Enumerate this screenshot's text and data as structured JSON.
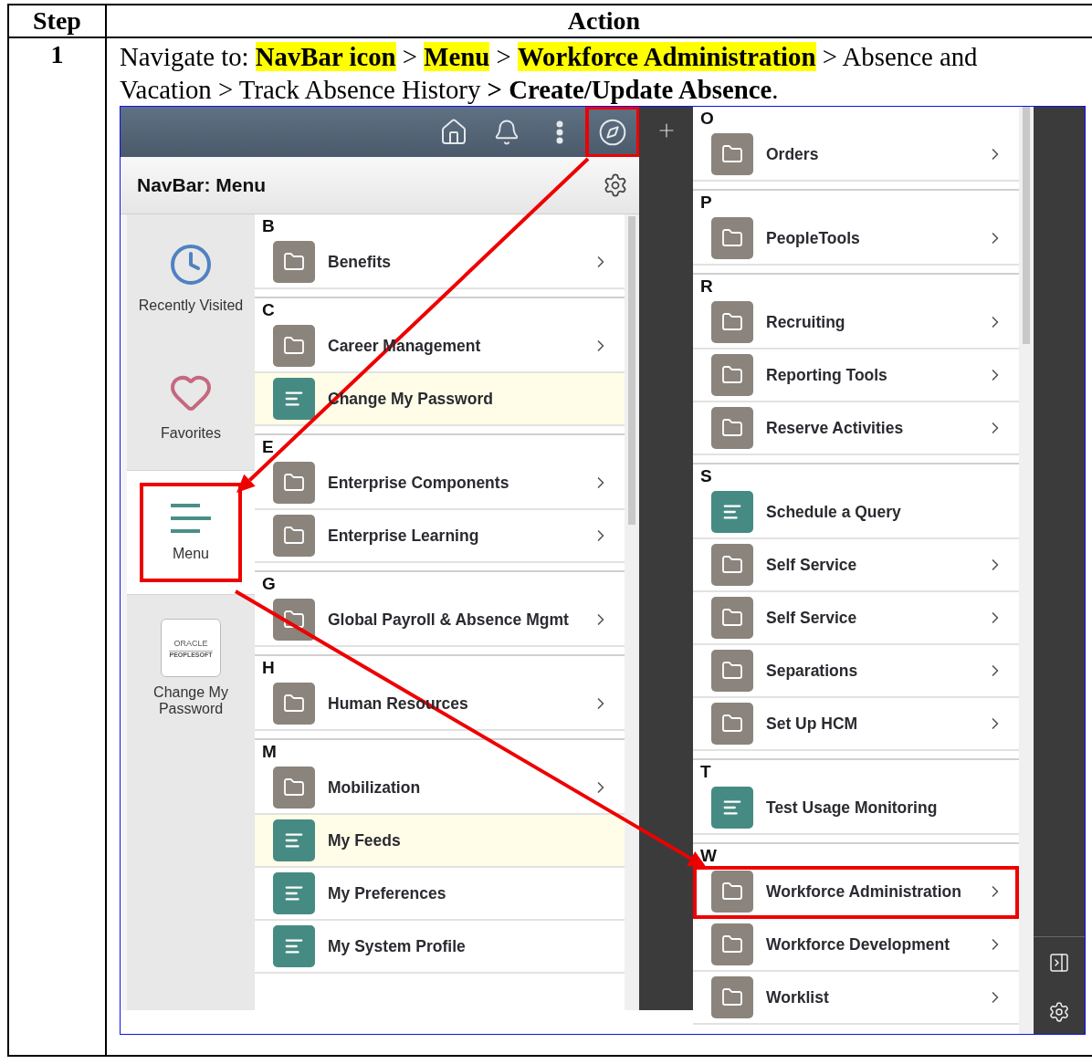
{
  "table": {
    "columns": [
      "Step",
      "Action"
    ],
    "rows": [
      {
        "step": "1",
        "instruction": [
          {
            "text": "Navigate to: ",
            "bold": false,
            "highlight": false
          },
          {
            "text": "NavBar icon",
            "bold": true,
            "highlight": true
          },
          {
            "text": " > ",
            "bold": false,
            "highlight": false
          },
          {
            "text": "Menu",
            "bold": true,
            "highlight": true
          },
          {
            "text": " > ",
            "bold": false,
            "highlight": false
          },
          {
            "text": "Workforce Administration",
            "bold": true,
            "highlight": true
          },
          {
            "text": " > Absence and Vacation > Track Absence History ",
            "bold": false,
            "highlight": false
          },
          {
            "text": "> Create/Update Absence",
            "bold": true,
            "highlight": false
          },
          {
            "text": ".",
            "bold": false,
            "highlight": false
          }
        ]
      }
    ]
  },
  "screenshot": {
    "top_bar": {
      "navbar_annotated": true
    },
    "panel_title": "NavBar: Menu",
    "nav_items": [
      {
        "kind": "recent",
        "label": "Recently Visited",
        "selected": false,
        "annotated": false
      },
      {
        "kind": "favorites",
        "label": "Favorites",
        "selected": false,
        "annotated": false
      },
      {
        "kind": "menu",
        "label": "Menu",
        "selected": true,
        "annotated": true
      },
      {
        "kind": "tile",
        "label": "Change My Password",
        "logo": [
          "ORACLE",
          "PEOPLESOFT"
        ],
        "selected": false,
        "annotated": false
      }
    ],
    "left_sections": [
      {
        "letter": "B",
        "items": [
          {
            "label": "Benefits",
            "kind": "folder",
            "highlighted": false,
            "annotated": false
          }
        ]
      },
      {
        "letter": "C",
        "items": [
          {
            "label": "Career Management",
            "kind": "folder",
            "highlighted": false,
            "annotated": false
          },
          {
            "label": "Change My Password",
            "kind": "page",
            "highlighted": true,
            "annotated": false
          }
        ]
      },
      {
        "letter": "E",
        "items": [
          {
            "label": "Enterprise Components",
            "kind": "folder",
            "highlighted": false,
            "annotated": false
          },
          {
            "label": "Enterprise Learning",
            "kind": "folder",
            "highlighted": false,
            "annotated": false
          }
        ]
      },
      {
        "letter": "G",
        "items": [
          {
            "label": "Global Payroll & Absence Mgmt",
            "kind": "folder",
            "highlighted": false,
            "annotated": false
          }
        ]
      },
      {
        "letter": "H",
        "items": [
          {
            "label": "Human Resources",
            "kind": "folder",
            "highlighted": false,
            "annotated": false
          }
        ]
      },
      {
        "letter": "M",
        "items": [
          {
            "label": "Mobilization",
            "kind": "folder",
            "highlighted": false,
            "annotated": false
          },
          {
            "label": "My Feeds",
            "kind": "page",
            "highlighted": true,
            "annotated": false
          },
          {
            "label": "My Preferences",
            "kind": "page",
            "highlighted": false,
            "annotated": false
          },
          {
            "label": "My System Profile",
            "kind": "page",
            "highlighted": false,
            "annotated": false
          }
        ]
      }
    ],
    "right_sections": [
      {
        "letter": "O",
        "items": [
          {
            "label": "Orders",
            "kind": "folder",
            "highlighted": false,
            "annotated": false
          }
        ]
      },
      {
        "letter": "P",
        "items": [
          {
            "label": "PeopleTools",
            "kind": "folder",
            "highlighted": false,
            "annotated": false
          }
        ]
      },
      {
        "letter": "R",
        "items": [
          {
            "label": "Recruiting",
            "kind": "folder",
            "highlighted": false,
            "annotated": false
          },
          {
            "label": "Reporting Tools",
            "kind": "folder",
            "highlighted": false,
            "annotated": false
          },
          {
            "label": "Reserve Activities",
            "kind": "folder",
            "highlighted": false,
            "annotated": false
          }
        ]
      },
      {
        "letter": "S",
        "items": [
          {
            "label": "Schedule a Query",
            "kind": "page",
            "highlighted": false,
            "annotated": false
          },
          {
            "label": "Self Service",
            "kind": "folder",
            "highlighted": false,
            "annotated": false
          },
          {
            "label": "Self Service",
            "kind": "folder",
            "highlighted": false,
            "annotated": false
          },
          {
            "label": "Separations",
            "kind": "folder",
            "highlighted": false,
            "annotated": false
          },
          {
            "label": "Set Up HCM",
            "kind": "folder",
            "highlighted": false,
            "annotated": false
          }
        ]
      },
      {
        "letter": "T",
        "items": [
          {
            "label": "Test Usage Monitoring",
            "kind": "page",
            "highlighted": false,
            "annotated": false
          }
        ]
      },
      {
        "letter": "W",
        "items": [
          {
            "label": "Workforce Administration",
            "kind": "folder",
            "highlighted": false,
            "annotated": true
          },
          {
            "label": "Workforce Development",
            "kind": "folder",
            "highlighted": false,
            "annotated": false
          },
          {
            "label": "Worklist",
            "kind": "folder",
            "highlighted": false,
            "annotated": false
          }
        ]
      }
    ]
  }
}
